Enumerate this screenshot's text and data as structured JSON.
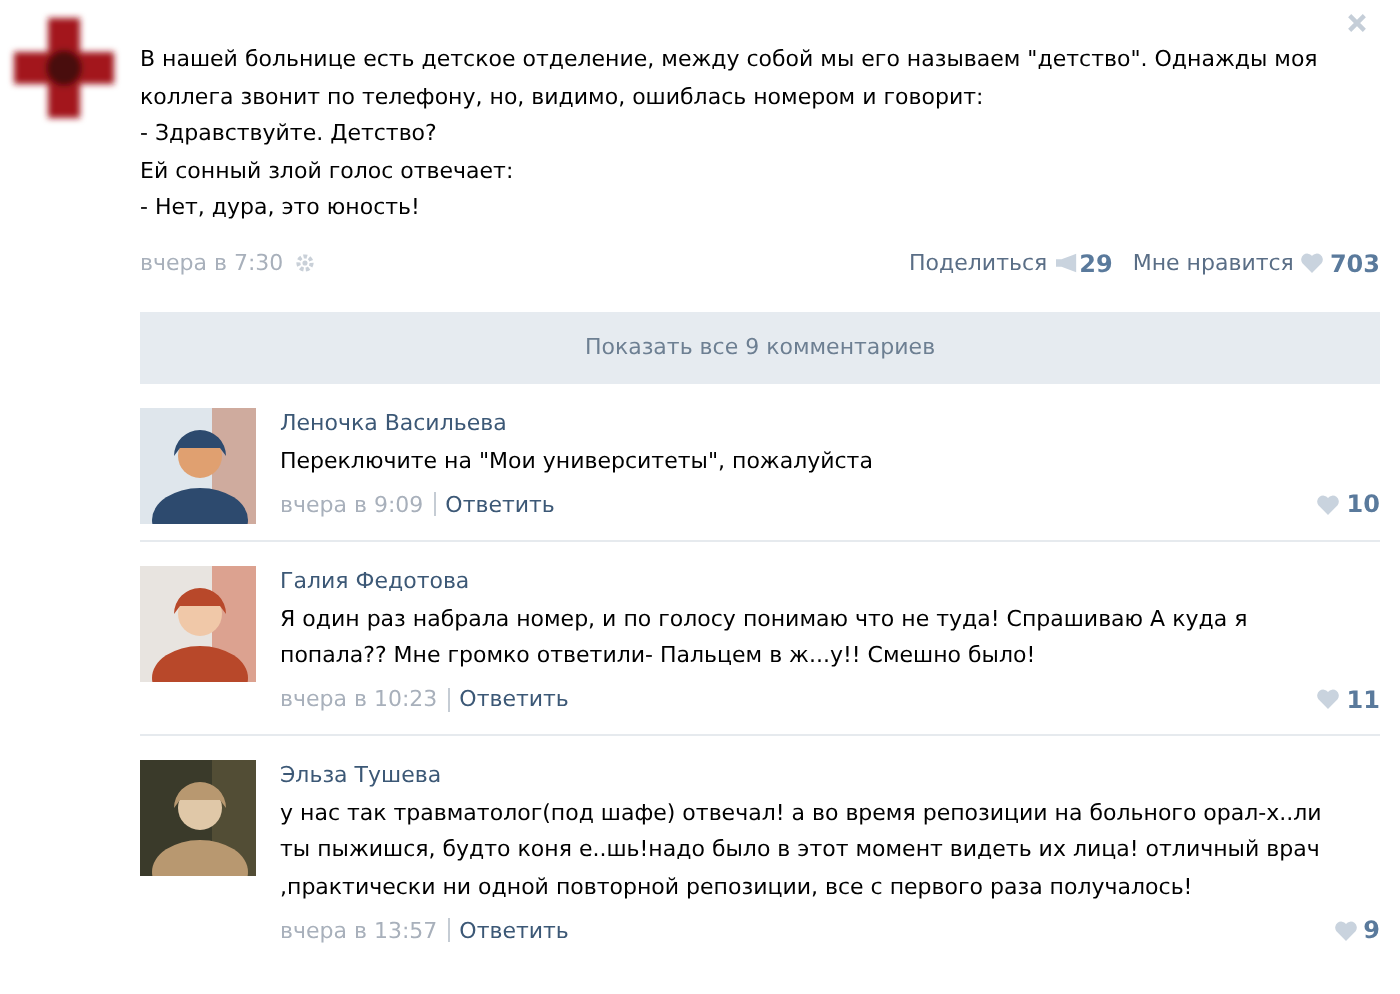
{
  "post": {
    "lines": [
      "В нашей больнице есть детское отделение, между собой мы его называем \"детство\". Однажды моя",
      "коллега звонит по телефону, но, видимо, ошиблась номером и говорит:",
      "- Здравствуйте. Детство?",
      "Ей сонный злой голос отвечает:",
      "- Нет, дура, это юность!"
    ],
    "time": "вчера в 7:30",
    "share_label": "Поделиться",
    "share_count": "29",
    "like_label": "Мне нравится",
    "like_count": "703"
  },
  "show_all_button": "Показать все 9 комментариев",
  "comments": [
    {
      "author": "Леночка Васильева",
      "lines": [
        "Переключите на \"Мои университеты\", пожалуйста"
      ],
      "time": "вчера в 9:09",
      "reply": "Ответить",
      "likes": "10"
    },
    {
      "author": "Галия Федотова",
      "lines": [
        "Я один раз набрала номер, и по голосу понимаю что не туда! Спрашиваю А куда я",
        "попала?? Мне громко ответили- Пальцем в ж...у!! Смешно было!"
      ],
      "time": "вчера в 10:23",
      "reply": "Ответить",
      "likes": "11"
    },
    {
      "author": "Эльза Тушева",
      "lines": [
        "у нас так травматолог(под шафе) отвечал! а во время репозиции на больного орал-х..ли",
        "ты пыжишся, будто коня е..шь!надо было в этот момент видеть их лица! отличный врач",
        ",практически ни одной повторной репозиции, все с первого раза получалось!"
      ],
      "time": "вчера в 13:57",
      "reply": "Ответить",
      "likes": "9"
    }
  ]
}
